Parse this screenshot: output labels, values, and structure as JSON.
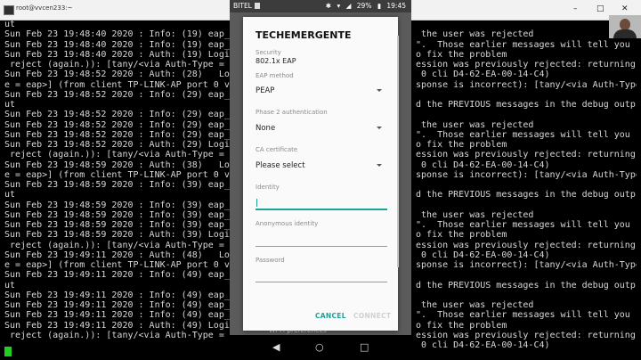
{
  "terminal": {
    "title": "root@vvcen233:~",
    "left_lines": [
      "ut",
      "Sun Feb 23 19:48:40 2020 : Info: (19) eap_",
      "Sun Feb 23 19:48:40 2020 : Info: (19) eap_",
      "Sun Feb 23 19:48:40 2020 : Auth: (19) Logi",
      " reject (again.)): [tany/<via Auth-Type = ",
      "Sun Feb 23 19:48:52 2020 : Auth: (28)   Lo",
      "e = eap>] (from client TP-LINK-AP port 0 v",
      "Sun Feb 23 19:48:52 2020 : Info: (29) eap_",
      "ut",
      "Sun Feb 23 19:48:52 2020 : Info: (29) eap_",
      "Sun Feb 23 19:48:52 2020 : Info: (29) eap_",
      "Sun Feb 23 19:48:52 2020 : Info: (29) eap_",
      "Sun Feb 23 19:48:52 2020 : Auth: (29) Logi",
      " reject (again.)): [tany/<via Auth-Type = ",
      "Sun Feb 23 19:48:59 2020 : Auth: (38)   Lo",
      "e = eap>] (from client TP-LINK-AP port 0 v",
      "Sun Feb 23 19:48:59 2020 : Info: (39) eap_",
      "ut",
      "Sun Feb 23 19:48:59 2020 : Info: (39) eap_",
      "Sun Feb 23 19:48:59 2020 : Info: (39) eap_",
      "Sun Feb 23 19:48:59 2020 : Info: (39) eap_",
      "Sun Feb 23 19:48:59 2020 : Auth: (39) Logi",
      " reject (again.)): [tany/<via Auth-Type = ",
      "Sun Feb 23 19:49:11 2020 : Auth: (48)   Lo",
      "e = eap>] (from client TP-LINK-AP port 0 v",
      "Sun Feb 23 19:49:11 2020 : Info: (49) eap_",
      "ut",
      "Sun Feb 23 19:49:11 2020 : Info: (49) eap_",
      "Sun Feb 23 19:49:11 2020 : Info: (49) eap_",
      "Sun Feb 23 19:49:11 2020 : Info: (49) eap_",
      "Sun Feb 23 19:49:11 2020 : Auth: (49) Logi",
      " reject (again.)): [tany/<via Auth-Type = "
    ],
    "right_lines": [
      "",
      " the user was rejected",
      "\".  Those earlier messages will tell you",
      "o fix the problem",
      "ession was previously rejected: returning",
      " 0 cli D4-62-EA-00-14-C4)",
      "sponse is incorrect): [tany/<via Auth-Type",
      "",
      "d the PREVIOUS messages in the debug outp",
      "",
      " the user was rejected",
      "\".  Those earlier messages will tell you",
      "o fix the problem",
      "ession was previously rejected: returning",
      " 0 cli D4-62-EA-00-14-C4)",
      "sponse is incorrect): [tany/<via Auth-Type",
      "",
      "d the PREVIOUS messages in the debug outp",
      "",
      " the user was rejected",
      "\".  Those earlier messages will tell you",
      "o fix the problem",
      "ession was previously rejected: returning",
      " 0 cli D4-62-EA-00-14-C4)",
      "sponse is incorrect): [tany/<via Auth-Type",
      "",
      "d the PREVIOUS messages in the debug outp",
      "",
      " the user was rejected",
      "\".  Those earlier messages will tell you",
      "o fix the problem",
      "ession was previously rejected: returning",
      " 0 cli D4-62-EA-00-14-C4)"
    ],
    "window_buttons": [
      "–",
      "□",
      "✕"
    ]
  },
  "phone": {
    "status": {
      "carrier": "BITEL",
      "battery": "29%",
      "time": "19:45"
    },
    "background_text": "Wi-Fi preferences",
    "dialog": {
      "title": "TECHEMERGENTE",
      "security_label": "Security",
      "security_value": "802.1x EAP",
      "eap_method_label": "EAP method",
      "eap_method_value": "PEAP",
      "phase2_label": "Phase 2 authentication",
      "phase2_value": "None",
      "ca_label": "CA certificate",
      "ca_value": "Please select",
      "identity_label": "Identity",
      "identity_value": "",
      "anon_label": "Anonymous identity",
      "anon_value": "",
      "password_label": "Password",
      "password_value": "",
      "cancel": "CANCEL",
      "connect": "CONNECT"
    },
    "colors": {
      "accent": "#1aa59a",
      "dialog_bg": "#fafafa"
    }
  }
}
